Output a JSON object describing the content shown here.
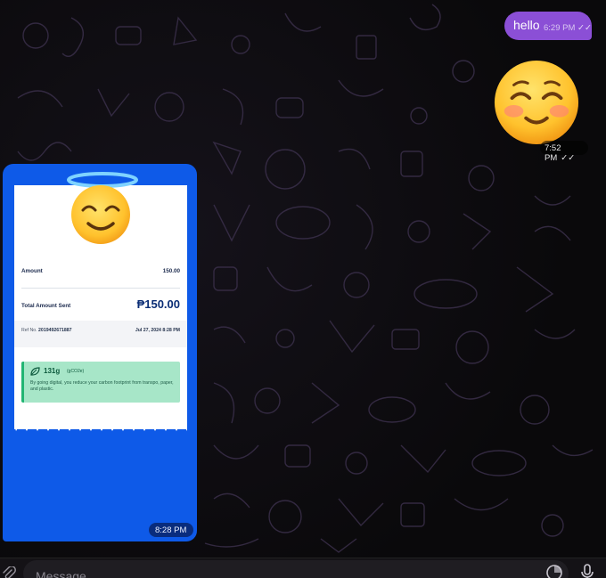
{
  "messages": {
    "outgoing_text": {
      "text": "hello",
      "time": "6:29 PM",
      "status": "✓✓"
    },
    "outgoing_sticker": {
      "emoji": "smiling-face-with-smiling-eyes",
      "time": "7:52 PM",
      "status": "✓✓"
    },
    "incoming_image": {
      "time": "8:28 PM",
      "receipt": {
        "amount_label": "Amount",
        "amount_value": "150.00",
        "total_label": "Total Amount Sent",
        "total_value": "₱150.00",
        "ref_label": "Ref No.",
        "ref_number": "2019492671887",
        "date": "Jul 27, 2024 8:28 PM",
        "eco_amount": "131g",
        "eco_unit": "(gCO2e)",
        "eco_text": "By going digital, you reduce your carbon footprint from transpo, paper, and plastic."
      },
      "overlay_emoji": "smiling-face-with-halo"
    }
  },
  "input": {
    "placeholder": "Message"
  },
  "colors": {
    "outgoing_bubble": "#8b4fd6",
    "receipt_background": "#0e5ae8",
    "eco_green": "#a7e6c8"
  }
}
